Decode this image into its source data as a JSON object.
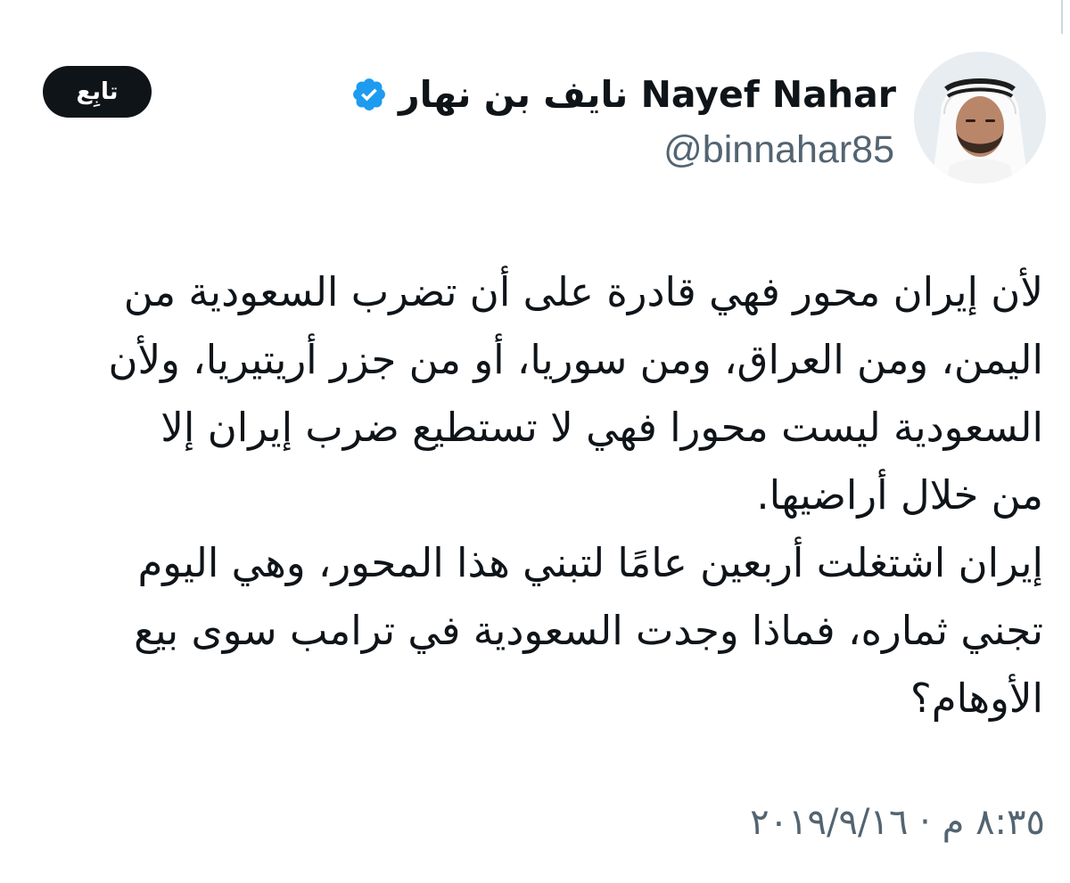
{
  "author": {
    "display_name": "نايف بن نهار Nayef Nahar",
    "handle": "@binnahar85",
    "verified": true,
    "avatar_icon": "person-in-ghutra-avatar"
  },
  "actions": {
    "follow_label": "تابِع"
  },
  "tweet": {
    "lines": [
      "لأن إيران محور فهي قادرة على أن تضرب السعودية من",
      "اليمن، ومن العراق، ومن سوريا، أو من جزر أريتيريا، ولأن",
      "السعودية ليست محورا فهي لا تستطيع ضرب إيران إلا",
      "من خلال أراضيها.",
      "إيران اشتغلت أربعين عامًا لتبني هذا المحور، وهي اليوم",
      "تجني ثماره، فماذا وجدت السعودية في ترامب سوى بيع",
      "الأوهام؟"
    ],
    "timestamp": "٨:٣٥ م · ٢٠١٩/٩/١٦"
  },
  "colors": {
    "text": "#0f1419",
    "secondary": "#536471",
    "verified": "#1d9bf0",
    "button_bg": "#0f1419",
    "button_text": "#ffffff"
  }
}
